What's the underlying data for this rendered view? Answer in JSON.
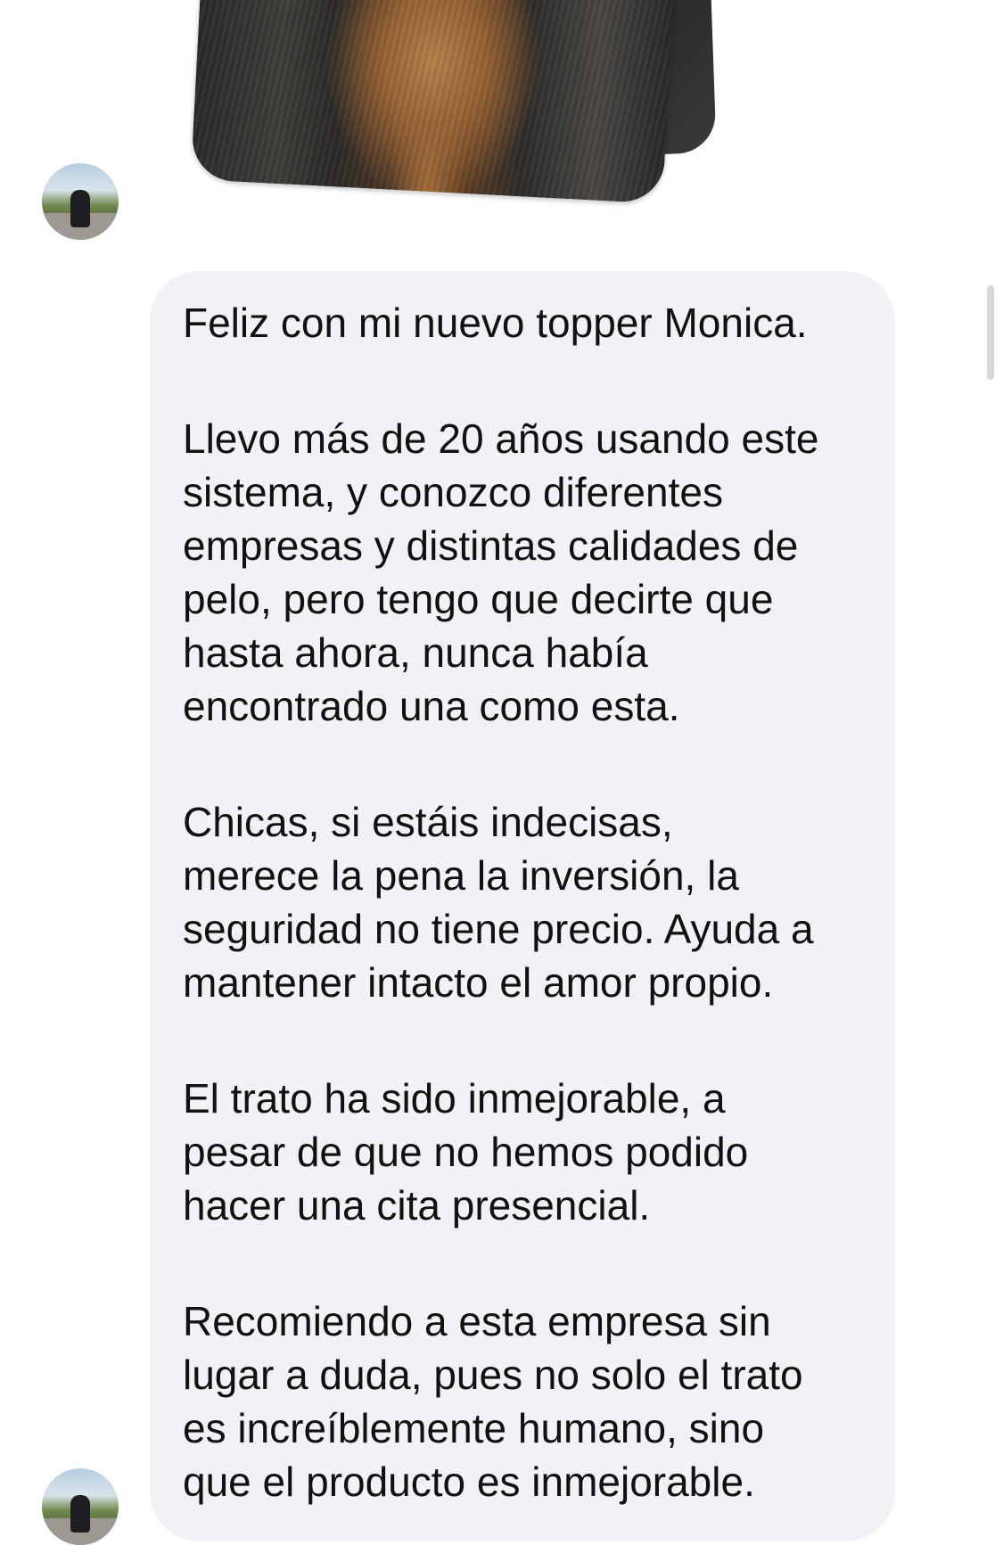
{
  "conversation": {
    "attachment": {
      "icon": "photo-stack-image"
    },
    "message": {
      "paragraphs": [
        "Feliz con mi nuevo topper Monica.",
        "Llevo más de 20 años usando este\nsistema, y conozco diferentes\nempresas y distintas calidades de\npelo, pero tengo que decirte que\nhasta ahora, nunca había\nencontrado una como esta.",
        "Chicas, si estáis indecisas,\nmerece la pena la inversión, la\nseguridad no tiene precio. Ayuda a\nmantener intacto el amor propio.",
        "El trato ha sido inmejorable, a\npesar de que no hemos podido\nhacer una cita presencial.",
        "Recomiendo a esta empresa sin\nlugar a duda, pues no solo el trato\nes increíblemente humano, sino\nque el producto es inmejorable."
      ]
    },
    "colors": {
      "bubble_background": "#f1f2f5",
      "text": "#111111",
      "page_background": "#ffffff"
    }
  }
}
